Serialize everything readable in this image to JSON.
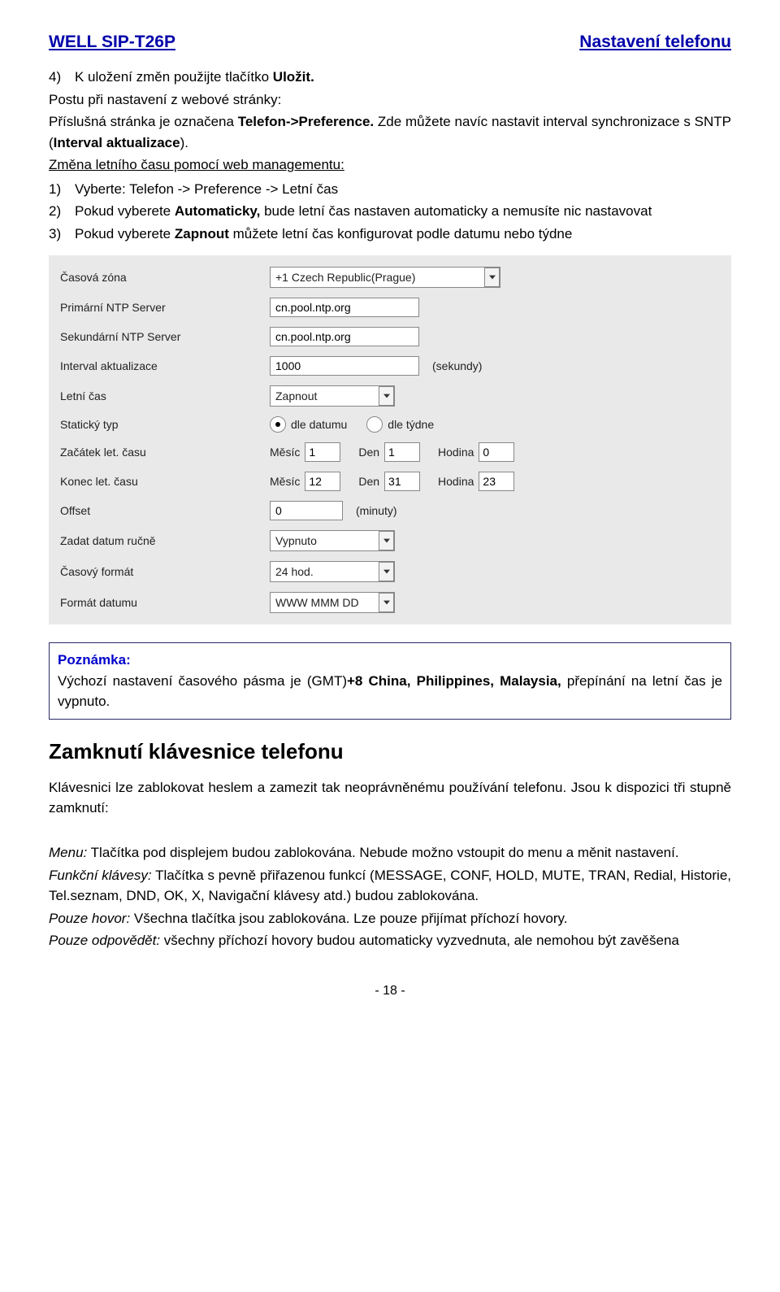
{
  "header": {
    "left": "WELL SIP-T26P",
    "right": "Nastavení telefonu"
  },
  "intro": {
    "item4_num": "4)",
    "item4_a": "K uložení změn použijte tlačítko ",
    "item4_b": "Uložit.",
    "p1": "Postu při nastavení z webové stránky:",
    "p2_a": "Příslušná stránka je označena ",
    "p2_b": "Telefon->Preference.",
    "p2_c": " Zde můžete navíc nastavit interval synchronizace s SNTP (",
    "p2_d": "Interval aktualizace",
    "p2_e": ").",
    "p3": "Změna letního času pomocí web managementu:",
    "ol": [
      {
        "n": "1)",
        "t_a": "Vyberte: Telefon -> Preference -> Letní čas",
        "t_b": "",
        "t_c": ""
      },
      {
        "n": "2)",
        "t_a": "Pokud vyberete ",
        "t_b": "Automaticky,",
        "t_c": " bude letní čas nastaven automaticky a nemusíte nic nastavovat"
      },
      {
        "n": "3)",
        "t_a": "Pokud vyberete ",
        "t_b": "Zapnout",
        "t_c": " můžete letní čas konfigurovat podle datumu nebo týdne"
      }
    ]
  },
  "form": {
    "labels": {
      "tz": "Časová zóna",
      "ntp1": "Primární NTP Server",
      "ntp2": "Sekundární NTP Server",
      "interval": "Interval aktualizace",
      "dst": "Letní čas",
      "static": "Statický typ",
      "start": "Začátek let. času",
      "end": "Konec let. času",
      "offset": "Offset",
      "manual": "Zadat datum ručně",
      "clockfmt": "Časový formát",
      "datefmt": "Formát datumu"
    },
    "values": {
      "tz": "+1 Czech Republic(Prague)",
      "ntp1": "cn.pool.ntp.org",
      "ntp2": "cn.pool.ntp.org",
      "interval": "1000",
      "interval_unit": "(sekundy)",
      "dst": "Zapnout",
      "radio_date": "dle datumu",
      "radio_week": "dle týdne",
      "month_label": "Měsíc",
      "day_label": "Den",
      "hour_label": "Hodina",
      "start_m": "1",
      "start_d": "1",
      "start_h": "0",
      "end_m": "12",
      "end_d": "31",
      "end_h": "23",
      "offset": "0",
      "offset_unit": "(minuty)",
      "manual": "Vypnuto",
      "clockfmt": "24 hod.",
      "datefmt": "WWW MMM DD"
    }
  },
  "note": {
    "title": "Poznámka:",
    "body_a": "Výchozí nastavení časového pásma je (GMT)",
    "body_b": "+8 China, Philippines, Malaysia,",
    "body_c": " přepínání na letní čas je vypnuto."
  },
  "section2": {
    "title": "Zamknutí klávesnice telefonu",
    "p1": "Klávesnici lze zablokovat heslem a zamezit tak neoprávněnému používání telefonu. Jsou k dispozici tři stupně zamknutí:",
    "menu_label": "Menu:",
    "menu_text": " Tlačítka pod displejem budou zablokována. Nebude možno vstoupit do menu a měnit nastavení.",
    "func_label": "Funkční klávesy:",
    "func_text": " Tlačítka s pevně přiřazenou funkcí (MESSAGE, CONF, HOLD, MUTE, TRAN, Redial, Historie, Tel.seznam, DND, OK, X, Navigační klávesy atd.) budou zablokována.",
    "callonly_label": "Pouze hovor:",
    "callonly_text": " Všechna tlačítka jsou zablokována. Lze pouze přijímat příchozí hovory.",
    "answeronly_label": "Pouze odpovědět:",
    "answeronly_text": " všechny příchozí hovory budou automaticky vyzvednuta, ale nemohou být zavěšena"
  },
  "footer": "- 18 -"
}
